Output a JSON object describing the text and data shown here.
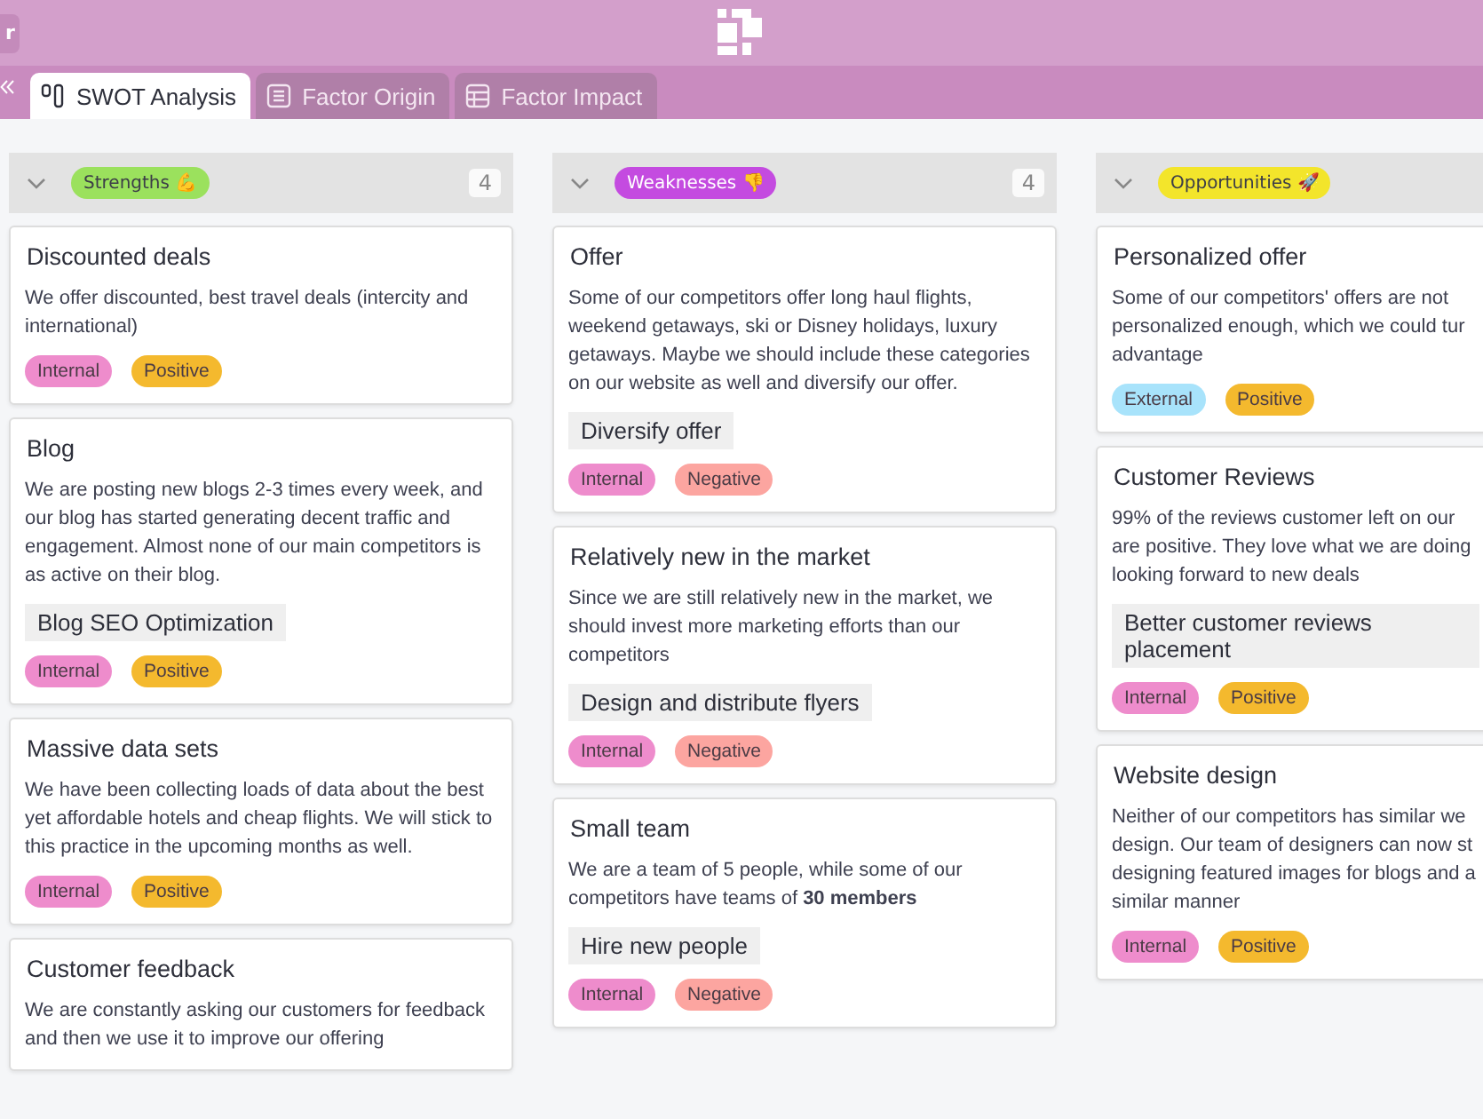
{
  "header": {
    "left_button": "r"
  },
  "tabs": [
    {
      "label": "SWOT Analysis",
      "kind": "kanban",
      "selected": true
    },
    {
      "label": "Factor Origin",
      "kind": "list",
      "selected": false
    },
    {
      "label": "Factor Impact",
      "kind": "grid",
      "selected": false
    }
  ],
  "columns": [
    {
      "label": "Strengths 💪",
      "color": "#9be15d",
      "count": "4",
      "cards": [
        {
          "title": "Discounted deals",
          "text": "We offer discounted, best travel deals (intercity and international)",
          "tags": [
            {
              "label": "Internal",
              "color": "#ee8ccc"
            },
            {
              "label": "Positive",
              "color": "#f4b92e"
            }
          ]
        },
        {
          "title": "Blog",
          "text": "We are posting new blogs 2-3 times every week, and our blog has started generating decent traffic and engagement. Almost none of our main competitors is as active on their blog.",
          "action": "Blog SEO Optimization",
          "tags": [
            {
              "label": "Internal",
              "color": "#ee8ccc"
            },
            {
              "label": "Positive",
              "color": "#f4b92e"
            }
          ]
        },
        {
          "title": "Massive data sets",
          "text": "We have been collecting loads of data about the best yet affordable hotels and cheap flights. We will stick to this practice in the upcoming months as well.",
          "tags": [
            {
              "label": "Internal",
              "color": "#ee8ccc"
            },
            {
              "label": "Positive",
              "color": "#f4b92e"
            }
          ]
        },
        {
          "title": "Customer feedback",
          "text": "We are constantly asking our customers for feedback and then we use it to improve our offering"
        }
      ]
    },
    {
      "label": "Weaknesses 👎",
      "color": "#c44be0",
      "count": "4",
      "cards": [
        {
          "title": "Offer",
          "text": "Some of our competitors offer long haul flights, weekend getaways, ski or Disney holidays, luxury getaways. Maybe we should include these categories on our website as well and diversify our offer.",
          "action": "Diversify offer",
          "tags": [
            {
              "label": "Internal",
              "color": "#ee8ccc"
            },
            {
              "label": "Negative",
              "color": "#fca5a0"
            }
          ]
        },
        {
          "title": "Relatively new in the market",
          "text": "Since we are still relatively new in the market, we should invest more marketing efforts than our competitors",
          "action": "Design and distribute flyers",
          "tags": [
            {
              "label": "Internal",
              "color": "#ee8ccc"
            },
            {
              "label": "Negative",
              "color": "#fca5a0"
            }
          ]
        },
        {
          "title": "Small team",
          "text": "We are a team of 5 people, while some of our competitors have teams of **30 members**",
          "action": "Hire new people",
          "tags": [
            {
              "label": "Internal",
              "color": "#ee8ccc"
            },
            {
              "label": "Negative",
              "color": "#fca5a0"
            }
          ]
        }
      ]
    },
    {
      "label": "Opportunities 🚀",
      "color": "#f3e52b",
      "cards": [
        {
          "title": "Personalized offer",
          "text": "Some of our competitors' offers are not personalized enough, which we could tur advantage",
          "tags": [
            {
              "label": "External",
              "color": "#a8e3fb"
            },
            {
              "label": "Positive",
              "color": "#f4b92e"
            }
          ]
        },
        {
          "title": "Customer Reviews",
          "text": "99% of the reviews customer left on our are positive. They love what we are doing looking forward to new deals",
          "action": "Better customer reviews placement",
          "tags": [
            {
              "label": "Internal",
              "color": "#ee8ccc"
            },
            {
              "label": "Positive",
              "color": "#f4b92e"
            }
          ]
        },
        {
          "title": "Website design",
          "text": "Neither of our competitors has similar we design. Our team of designers can now st designing featured images for blogs and a similar manner",
          "tags": [
            {
              "label": "Internal",
              "color": "#ee8ccc"
            },
            {
              "label": "Positive",
              "color": "#f4b92e"
            }
          ]
        }
      ]
    }
  ]
}
